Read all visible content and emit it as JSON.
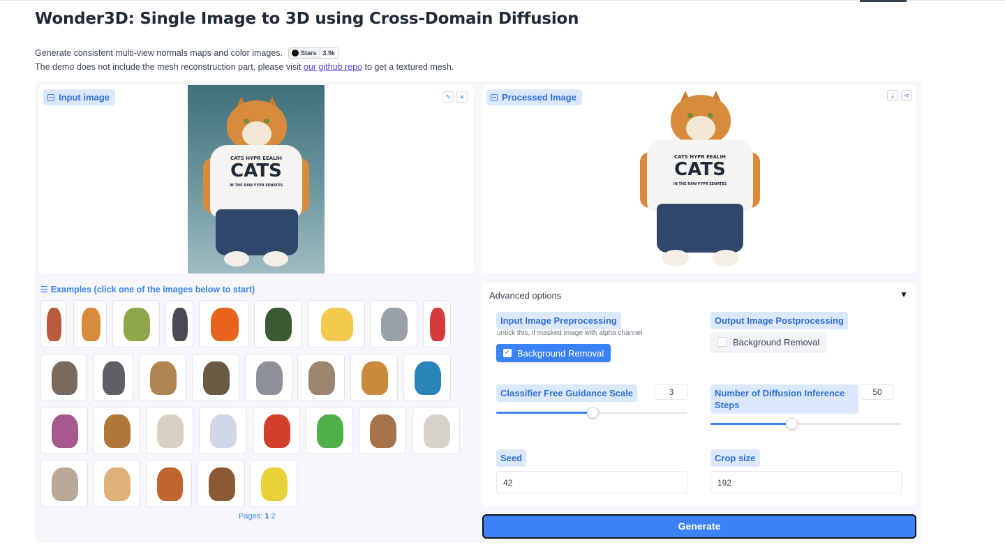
{
  "header": {
    "title": "Wonder3D: Single Image to 3D using Cross-Domain Diffusion",
    "desc_line1": "Generate consistent multi-view normals maps and color images.",
    "stars_label": "Stars",
    "stars_count": "3.9k",
    "desc_line2_before": "The demo does not include the mesh reconstruction part, please visit ",
    "desc_link": "our github repo",
    "desc_line2_after": " to get a textured mesh."
  },
  "input_image": {
    "label": "Input image",
    "icon": "image-icon",
    "edit_icon": "pencil-icon",
    "clear_icon": "close-icon",
    "shirt_text_small": "CATS HYPR EEALIH",
    "shirt_text_big": "CATS",
    "shirt_text_tiny": "IN THE RAW FYPR EENATES"
  },
  "processed_image": {
    "label": "Processed Image",
    "icon": "image-icon",
    "download_icon": "download-icon",
    "share_icon": "share-icon"
  },
  "examples": {
    "title": "Examples (click one of the images below to start)",
    "list_icon": "list-icon",
    "row1": [
      {
        "name": "example-figure-1",
        "color": "#b85a3c"
      },
      {
        "name": "example-cat",
        "color": "#d98b3c"
      },
      {
        "name": "example-egg-chair",
        "color": "#8fa64a"
      },
      {
        "name": "example-armored-figure",
        "color": "#4a4a55"
      },
      {
        "name": "example-firefox",
        "color": "#e8641c"
      },
      {
        "name": "example-chimp-astronaut",
        "color": "#3a5a32"
      },
      {
        "name": "example-minion",
        "color": "#f2c94c"
      },
      {
        "name": "example-tiger-head",
        "color": "#9aa0a8"
      },
      {
        "name": "example-powerpuff",
        "color": "#d63a3a"
      }
    ],
    "row2": [
      {
        "name": "example-dog",
        "color": "#7a6a5e"
      },
      {
        "name": "example-elephant",
        "color": "#5f6066"
      },
      {
        "name": "example-camel",
        "color": "#b08552"
      },
      {
        "name": "example-tortoise",
        "color": "#6b5a44"
      },
      {
        "name": "example-koala",
        "color": "#8d9096"
      },
      {
        "name": "example-rabbit",
        "color": "#9c8570"
      },
      {
        "name": "example-bear-toy",
        "color": "#c98a3c"
      },
      {
        "name": "example-kingfisher",
        "color": "#2a84b8"
      }
    ],
    "row3": [
      {
        "name": "example-treasure-chest",
        "color": "#a65a8c"
      },
      {
        "name": "example-bread-crate",
        "color": "#b07838"
      },
      {
        "name": "example-squirrel",
        "color": "#d8d0c2"
      },
      {
        "name": "example-cartoon-cat",
        "color": "#cfd6e6"
      },
      {
        "name": "example-tomato-octopus",
        "color": "#d1402a"
      },
      {
        "name": "example-rainbow-cat",
        "color": "#4fb04a"
      },
      {
        "name": "example-monkey",
        "color": "#a5724a"
      },
      {
        "name": "example-llama",
        "color": "#d6d2ca"
      }
    ],
    "row4": [
      {
        "name": "example-ghost-figure",
        "color": "#b9a898"
      },
      {
        "name": "example-fox-toy",
        "color": "#e0b07a"
      },
      {
        "name": "example-fox",
        "color": "#c0652e"
      },
      {
        "name": "example-groot",
        "color": "#8a5a34"
      },
      {
        "name": "example-spongebob",
        "color": "#e8d23a"
      }
    ],
    "pages_label": "Pages:",
    "page_current": "1",
    "page_other": "2"
  },
  "advanced": {
    "title": "Advanced options",
    "toggle_icon": "triangle-down-icon",
    "toggle_glyph": "▼",
    "pre_label": "Input Image Preprocessing",
    "pre_hint": "untick this, if masked image with alpha channel",
    "pre_checkbox_label": "Background Removal",
    "pre_checked": true,
    "post_label": "Output Image Postprocessing",
    "post_checkbox_label": "Background Removal",
    "post_checked": false,
    "cfg_label": "Classifier Free Guidance Scale",
    "cfg_value": "3",
    "cfg_fill": 0.5,
    "steps_label_1": "Number of Diffusion Inference",
    "steps_label_2": "Steps",
    "steps_value": "50",
    "steps_fill": 0.42,
    "seed_label": "Seed",
    "seed_value": "42",
    "crop_label": "Crop size",
    "crop_value": "192"
  },
  "generate_label": "Generate"
}
